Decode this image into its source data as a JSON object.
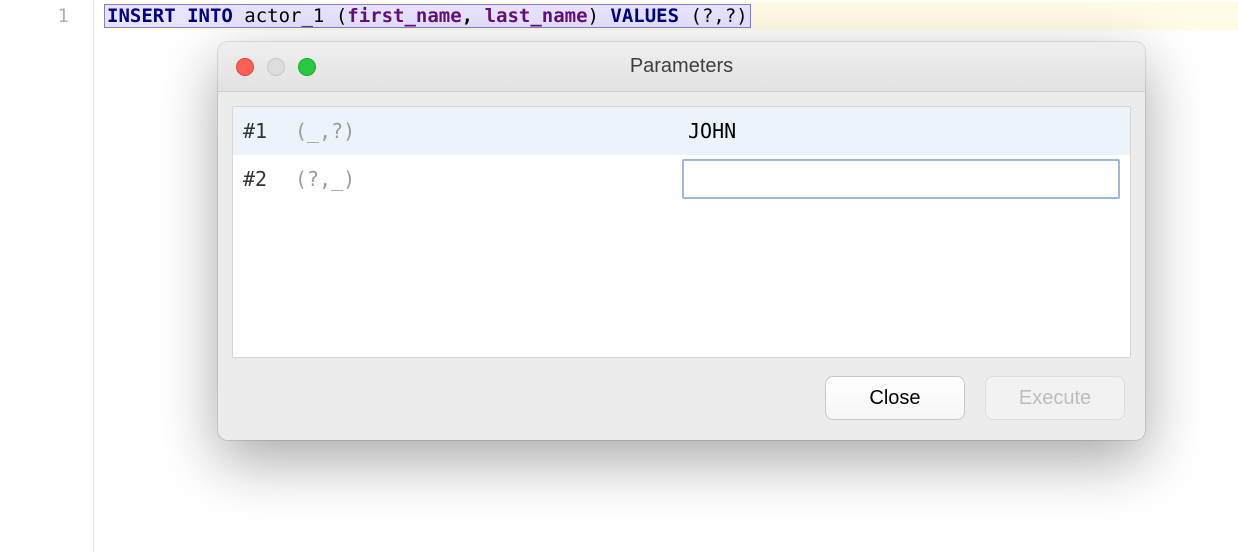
{
  "editor": {
    "line_number": "1",
    "sql": {
      "insert": "INSERT",
      "into": "INTO",
      "table": " actor_1 ",
      "lparen1": "(",
      "col1": "first_name",
      "comma1": ",",
      "space1": " ",
      "col2": "last_name",
      "rparen1": ")",
      "space2": " ",
      "values_kw": "VALUES",
      "space3": " ",
      "params": "(?,?)"
    }
  },
  "dialog": {
    "title": "Parameters",
    "rows": [
      {
        "index": "#1",
        "pattern": "(_,?)",
        "value": "JOHN"
      },
      {
        "index": "#2",
        "pattern": "(?,_)",
        "value": ""
      }
    ],
    "buttons": {
      "close": "Close",
      "execute": "Execute"
    }
  }
}
